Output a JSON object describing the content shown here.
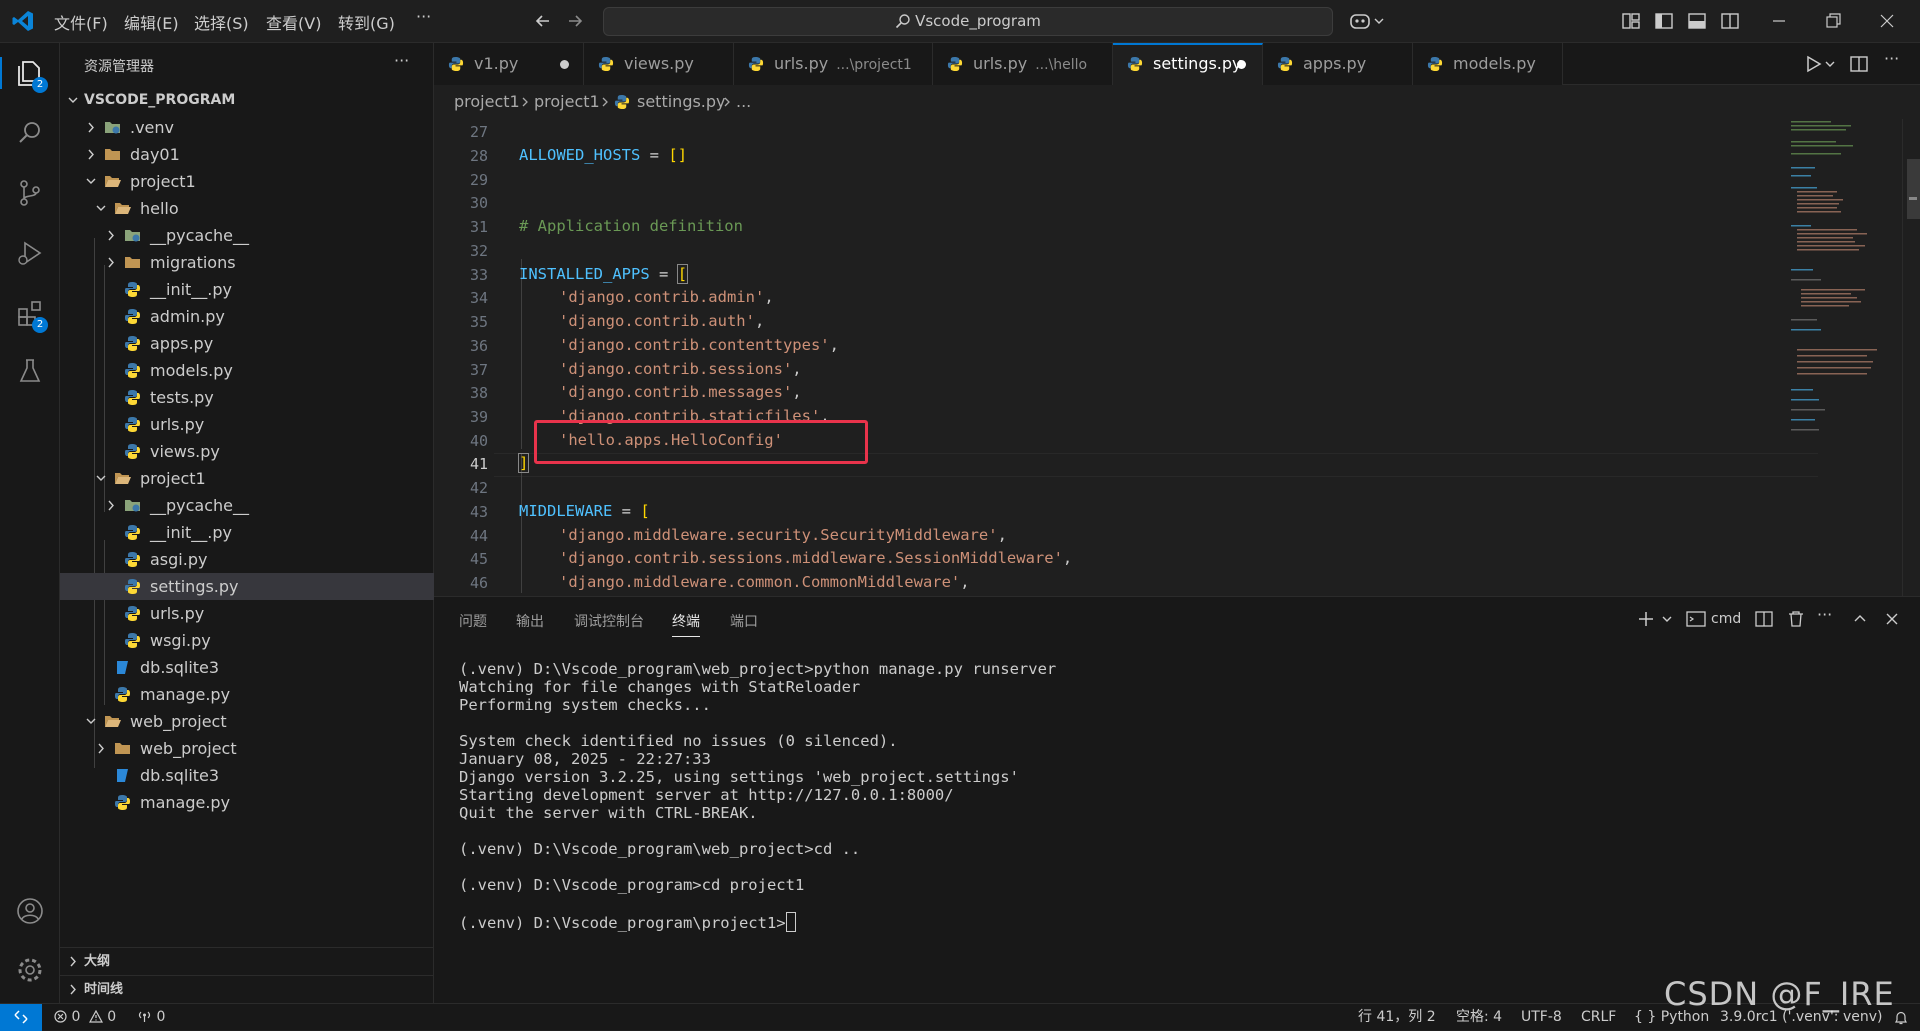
{
  "titlebar": {
    "menu": [
      "文件(F)",
      "编辑(E)",
      "选择(S)",
      "查看(V)",
      "转到(G)"
    ],
    "more": "···",
    "search_text": "Vscode_program"
  },
  "activitybar": {
    "explorer_badge": "2",
    "extensions_badge": "2"
  },
  "sidebar": {
    "title": "资源管理器",
    "more": "···",
    "root": "VSCODE_PROGRAM",
    "items": [
      ".venv",
      "day01",
      "project1",
      "hello",
      "__pycache__",
      "migrations",
      "__init__.py",
      "admin.py",
      "apps.py",
      "models.py",
      "tests.py",
      "urls.py",
      "views.py",
      "project1",
      "__pycache__",
      "__init__.py",
      "asgi.py",
      "settings.py",
      "urls.py",
      "wsgi.py",
      "db.sqlite3",
      "manage.py",
      "web_project",
      "web_project",
      "db.sqlite3",
      "manage.py"
    ],
    "outline": "大纲",
    "timeline": "时间线"
  },
  "tabs": [
    {
      "label": "v1.py",
      "desc": ""
    },
    {
      "label": "views.py",
      "desc": ""
    },
    {
      "label": "urls.py",
      "desc": "...\\project1"
    },
    {
      "label": "urls.py",
      "desc": "...\\hello"
    },
    {
      "label": "settings.py",
      "desc": ""
    },
    {
      "label": "apps.py",
      "desc": ""
    },
    {
      "label": "models.py",
      "desc": ""
    }
  ],
  "breadcrumb": {
    "seg1": "project1",
    "seg2": "project1",
    "seg3": "settings.py",
    "seg4": "..."
  },
  "editor": {
    "line_numbers": [
      "27",
      "28",
      "29",
      "30",
      "31",
      "32",
      "33",
      "34",
      "35",
      "36",
      "37",
      "38",
      "39",
      "40",
      "41",
      "42",
      "43",
      "44",
      "45",
      "46"
    ],
    "allowed_hosts_var": "ALLOWED_HOSTS",
    "allowed_hosts_val": "[]",
    "comment": "# Application definition",
    "installed_apps_var": "INSTALLED_APPS",
    "apps": [
      "'django.contrib.admin'",
      "'django.contrib.auth'",
      "'django.contrib.contenttypes'",
      "'django.contrib.sessions'",
      "'django.contrib.messages'",
      "'django.contrib.staticfiles'",
      "'hello.apps.HelloConfig'"
    ],
    "middleware_var": "MIDDLEWARE",
    "middleware": [
      "'django.middleware.security.SecurityMiddleware'",
      "'django.contrib.sessions.middleware.SessionMiddleware'",
      "'django.middleware.common.CommonMiddleware'"
    ],
    "eq": "=",
    "open_bracket": "[",
    "close_bracket": "]",
    "comma": ","
  },
  "panel": {
    "tabs": [
      "问题",
      "输出",
      "调试控制台",
      "终端",
      "端口"
    ],
    "shell": "cmd",
    "terminal_lines": [
      "(.venv) D:\\Vscode_program\\web_project>python manage.py runserver",
      "Watching for file changes with StatReloader",
      "Performing system checks...",
      "",
      "System check identified no issues (0 silenced).",
      "January 08, 2025 - 22:27:33",
      "Django version 3.2.25, using settings 'web_project.settings'",
      "Starting development server at http://127.0.0.1:8000/",
      "Quit the server with CTRL-BREAK.",
      "",
      "(.venv) D:\\Vscode_program\\web_project>cd ..",
      "",
      "(.venv) D:\\Vscode_program>cd project1",
      "",
      "(.venv) D:\\Vscode_program\\project1>"
    ]
  },
  "statusbar": {
    "errors": "0",
    "warnings": "0",
    "ports": "0",
    "position": "行 41，列 2",
    "spaces": "空格: 4",
    "encoding": "UTF-8",
    "eol": "CRLF",
    "language": "Python",
    "interpreter": "3.9.0rc1 ('.venv': venv)"
  },
  "watermark": "CSDN @F_IRE",
  "colors": {
    "accent": "#0078d4",
    "highlight_box": "#e8334b"
  }
}
